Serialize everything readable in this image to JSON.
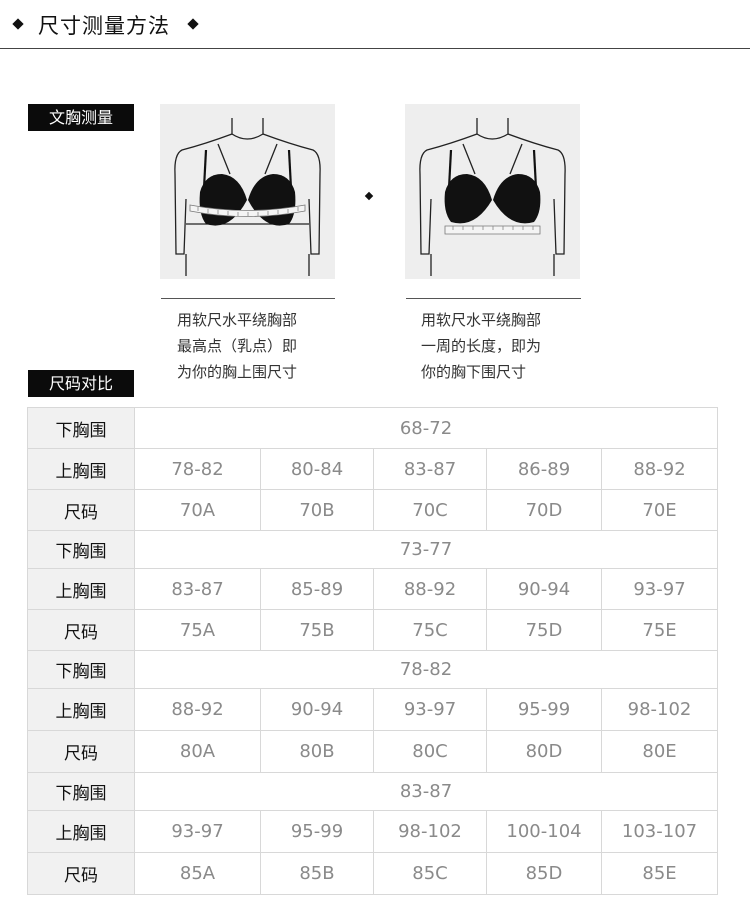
{
  "header": {
    "title": "尺寸测量方法"
  },
  "section_bust": {
    "label": "文胸测量"
  },
  "figures": [
    {
      "caption": [
        "用软尺水平绕胸部",
        "最高点（乳点）即",
        "为你的胸上围尺寸"
      ]
    },
    {
      "caption": [
        "用软尺水平绕胸部",
        "一周的长度，即为",
        "你的胸下围尺寸"
      ]
    }
  ],
  "section_size": {
    "label": "尺码对比"
  },
  "table": {
    "row_labels": {
      "under": "下胸围",
      "over": "上胸围",
      "size": "尺码"
    },
    "groups": [
      {
        "under": "68-72",
        "over": [
          "78-82",
          "80-84",
          "83-87",
          "86-89",
          "88-92"
        ],
        "sizes": [
          "70A",
          "70B",
          "70C",
          "70D",
          "70E"
        ]
      },
      {
        "under": "73-77",
        "over": [
          "83-87",
          "85-89",
          "88-92",
          "90-94",
          "93-97"
        ],
        "sizes": [
          "75A",
          "75B",
          "75C",
          "75D",
          "75E"
        ]
      },
      {
        "under": "78-82",
        "over": [
          "88-92",
          "90-94",
          "93-97",
          "95-99",
          "98-102"
        ],
        "sizes": [
          "80A",
          "80B",
          "80C",
          "80D",
          "80E"
        ]
      },
      {
        "under": "83-87",
        "over": [
          "93-97",
          "95-99",
          "98-102",
          "100-104",
          "103-107"
        ],
        "sizes": [
          "85A",
          "85B",
          "85C",
          "85D",
          "85E"
        ]
      }
    ]
  }
}
